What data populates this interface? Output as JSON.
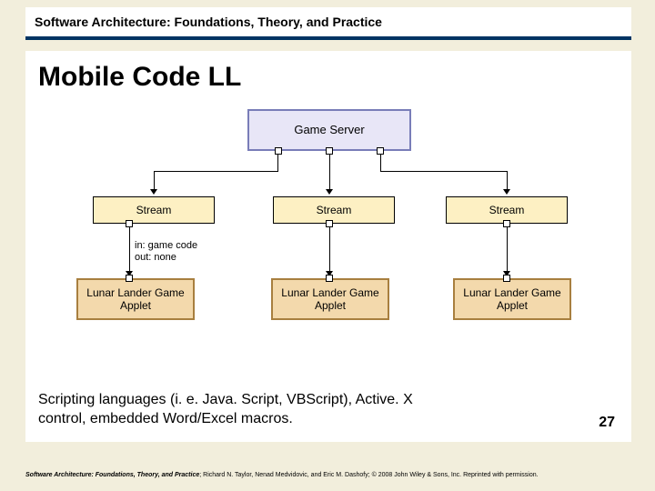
{
  "header": {
    "text": "Software Architecture: Foundations, Theory, and Practice"
  },
  "title": "Mobile Code LL",
  "diagram": {
    "server": {
      "label": "Game Server"
    },
    "streams": [
      {
        "label": "Stream"
      },
      {
        "label": "Stream"
      },
      {
        "label": "Stream"
      }
    ],
    "applets": [
      {
        "label": "Lunar Lander Game Applet"
      },
      {
        "label": "Lunar Lander Game Applet"
      },
      {
        "label": "Lunar Lander Game Applet"
      }
    ],
    "conn_annotation": "in: game code\nout: none"
  },
  "body_text": "Scripting languages (i. e. Java. Script, VBScript), Active. X control, embedded Word/Excel macros.",
  "page_number": "27",
  "footer": {
    "prefix": "Software Architecture: Foundations, Theory, and Practice",
    "rest": "; Richard N. Taylor, Nenad Medvidovic, and Eric M. Dashofy; © 2008 John Wiley & Sons, Inc. Reprinted with permission."
  },
  "chart_data": {
    "type": "diagram",
    "title": "Mobile Code LL",
    "nodes": [
      {
        "id": "server",
        "label": "Game Server",
        "kind": "component"
      },
      {
        "id": "stream1",
        "label": "Stream",
        "kind": "connector"
      },
      {
        "id": "stream2",
        "label": "Stream",
        "kind": "connector"
      },
      {
        "id": "stream3",
        "label": "Stream",
        "kind": "connector"
      },
      {
        "id": "applet1",
        "label": "Lunar Lander Game Applet",
        "kind": "component"
      },
      {
        "id": "applet2",
        "label": "Lunar Lander Game Applet",
        "kind": "component"
      },
      {
        "id": "applet3",
        "label": "Lunar Lander Game Applet",
        "kind": "component"
      }
    ],
    "edges": [
      {
        "from": "server",
        "to": "stream1"
      },
      {
        "from": "server",
        "to": "stream2"
      },
      {
        "from": "server",
        "to": "stream3"
      },
      {
        "from": "stream1",
        "to": "applet1",
        "annotation": "in: game code / out: none"
      },
      {
        "from": "stream2",
        "to": "applet2"
      },
      {
        "from": "stream3",
        "to": "applet3"
      }
    ]
  }
}
